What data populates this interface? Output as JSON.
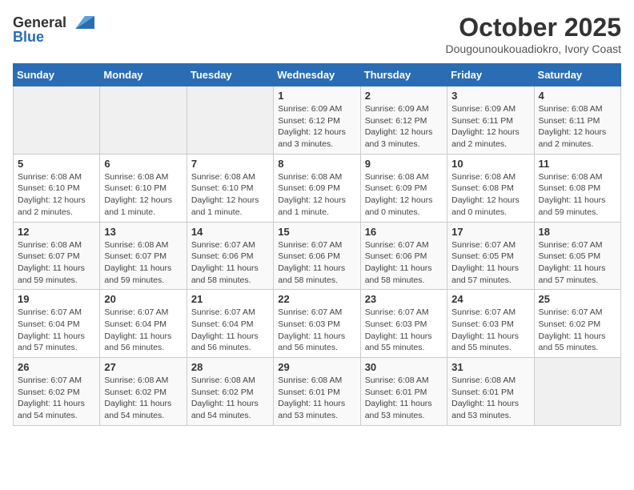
{
  "header": {
    "logo_general": "General",
    "logo_blue": "Blue",
    "month_title": "October 2025",
    "location": "Dougounoukouadiokro, Ivory Coast"
  },
  "days_of_week": [
    "Sunday",
    "Monday",
    "Tuesday",
    "Wednesday",
    "Thursday",
    "Friday",
    "Saturday"
  ],
  "weeks": [
    [
      {
        "day": "",
        "info": ""
      },
      {
        "day": "",
        "info": ""
      },
      {
        "day": "",
        "info": ""
      },
      {
        "day": "1",
        "info": "Sunrise: 6:09 AM\nSunset: 6:12 PM\nDaylight: 12 hours\nand 3 minutes."
      },
      {
        "day": "2",
        "info": "Sunrise: 6:09 AM\nSunset: 6:12 PM\nDaylight: 12 hours\nand 3 minutes."
      },
      {
        "day": "3",
        "info": "Sunrise: 6:09 AM\nSunset: 6:11 PM\nDaylight: 12 hours\nand 2 minutes."
      },
      {
        "day": "4",
        "info": "Sunrise: 6:08 AM\nSunset: 6:11 PM\nDaylight: 12 hours\nand 2 minutes."
      }
    ],
    [
      {
        "day": "5",
        "info": "Sunrise: 6:08 AM\nSunset: 6:10 PM\nDaylight: 12 hours\nand 2 minutes."
      },
      {
        "day": "6",
        "info": "Sunrise: 6:08 AM\nSunset: 6:10 PM\nDaylight: 12 hours\nand 1 minute."
      },
      {
        "day": "7",
        "info": "Sunrise: 6:08 AM\nSunset: 6:10 PM\nDaylight: 12 hours\nand 1 minute."
      },
      {
        "day": "8",
        "info": "Sunrise: 6:08 AM\nSunset: 6:09 PM\nDaylight: 12 hours\nand 1 minute."
      },
      {
        "day": "9",
        "info": "Sunrise: 6:08 AM\nSunset: 6:09 PM\nDaylight: 12 hours\nand 0 minutes."
      },
      {
        "day": "10",
        "info": "Sunrise: 6:08 AM\nSunset: 6:08 PM\nDaylight: 12 hours\nand 0 minutes."
      },
      {
        "day": "11",
        "info": "Sunrise: 6:08 AM\nSunset: 6:08 PM\nDaylight: 11 hours\nand 59 minutes."
      }
    ],
    [
      {
        "day": "12",
        "info": "Sunrise: 6:08 AM\nSunset: 6:07 PM\nDaylight: 11 hours\nand 59 minutes."
      },
      {
        "day": "13",
        "info": "Sunrise: 6:08 AM\nSunset: 6:07 PM\nDaylight: 11 hours\nand 59 minutes."
      },
      {
        "day": "14",
        "info": "Sunrise: 6:07 AM\nSunset: 6:06 PM\nDaylight: 11 hours\nand 58 minutes."
      },
      {
        "day": "15",
        "info": "Sunrise: 6:07 AM\nSunset: 6:06 PM\nDaylight: 11 hours\nand 58 minutes."
      },
      {
        "day": "16",
        "info": "Sunrise: 6:07 AM\nSunset: 6:06 PM\nDaylight: 11 hours\nand 58 minutes."
      },
      {
        "day": "17",
        "info": "Sunrise: 6:07 AM\nSunset: 6:05 PM\nDaylight: 11 hours\nand 57 minutes."
      },
      {
        "day": "18",
        "info": "Sunrise: 6:07 AM\nSunset: 6:05 PM\nDaylight: 11 hours\nand 57 minutes."
      }
    ],
    [
      {
        "day": "19",
        "info": "Sunrise: 6:07 AM\nSunset: 6:04 PM\nDaylight: 11 hours\nand 57 minutes."
      },
      {
        "day": "20",
        "info": "Sunrise: 6:07 AM\nSunset: 6:04 PM\nDaylight: 11 hours\nand 56 minutes."
      },
      {
        "day": "21",
        "info": "Sunrise: 6:07 AM\nSunset: 6:04 PM\nDaylight: 11 hours\nand 56 minutes."
      },
      {
        "day": "22",
        "info": "Sunrise: 6:07 AM\nSunset: 6:03 PM\nDaylight: 11 hours\nand 56 minutes."
      },
      {
        "day": "23",
        "info": "Sunrise: 6:07 AM\nSunset: 6:03 PM\nDaylight: 11 hours\nand 55 minutes."
      },
      {
        "day": "24",
        "info": "Sunrise: 6:07 AM\nSunset: 6:03 PM\nDaylight: 11 hours\nand 55 minutes."
      },
      {
        "day": "25",
        "info": "Sunrise: 6:07 AM\nSunset: 6:02 PM\nDaylight: 11 hours\nand 55 minutes."
      }
    ],
    [
      {
        "day": "26",
        "info": "Sunrise: 6:07 AM\nSunset: 6:02 PM\nDaylight: 11 hours\nand 54 minutes."
      },
      {
        "day": "27",
        "info": "Sunrise: 6:08 AM\nSunset: 6:02 PM\nDaylight: 11 hours\nand 54 minutes."
      },
      {
        "day": "28",
        "info": "Sunrise: 6:08 AM\nSunset: 6:02 PM\nDaylight: 11 hours\nand 54 minutes."
      },
      {
        "day": "29",
        "info": "Sunrise: 6:08 AM\nSunset: 6:01 PM\nDaylight: 11 hours\nand 53 minutes."
      },
      {
        "day": "30",
        "info": "Sunrise: 6:08 AM\nSunset: 6:01 PM\nDaylight: 11 hours\nand 53 minutes."
      },
      {
        "day": "31",
        "info": "Sunrise: 6:08 AM\nSunset: 6:01 PM\nDaylight: 11 hours\nand 53 minutes."
      },
      {
        "day": "",
        "info": ""
      }
    ]
  ]
}
